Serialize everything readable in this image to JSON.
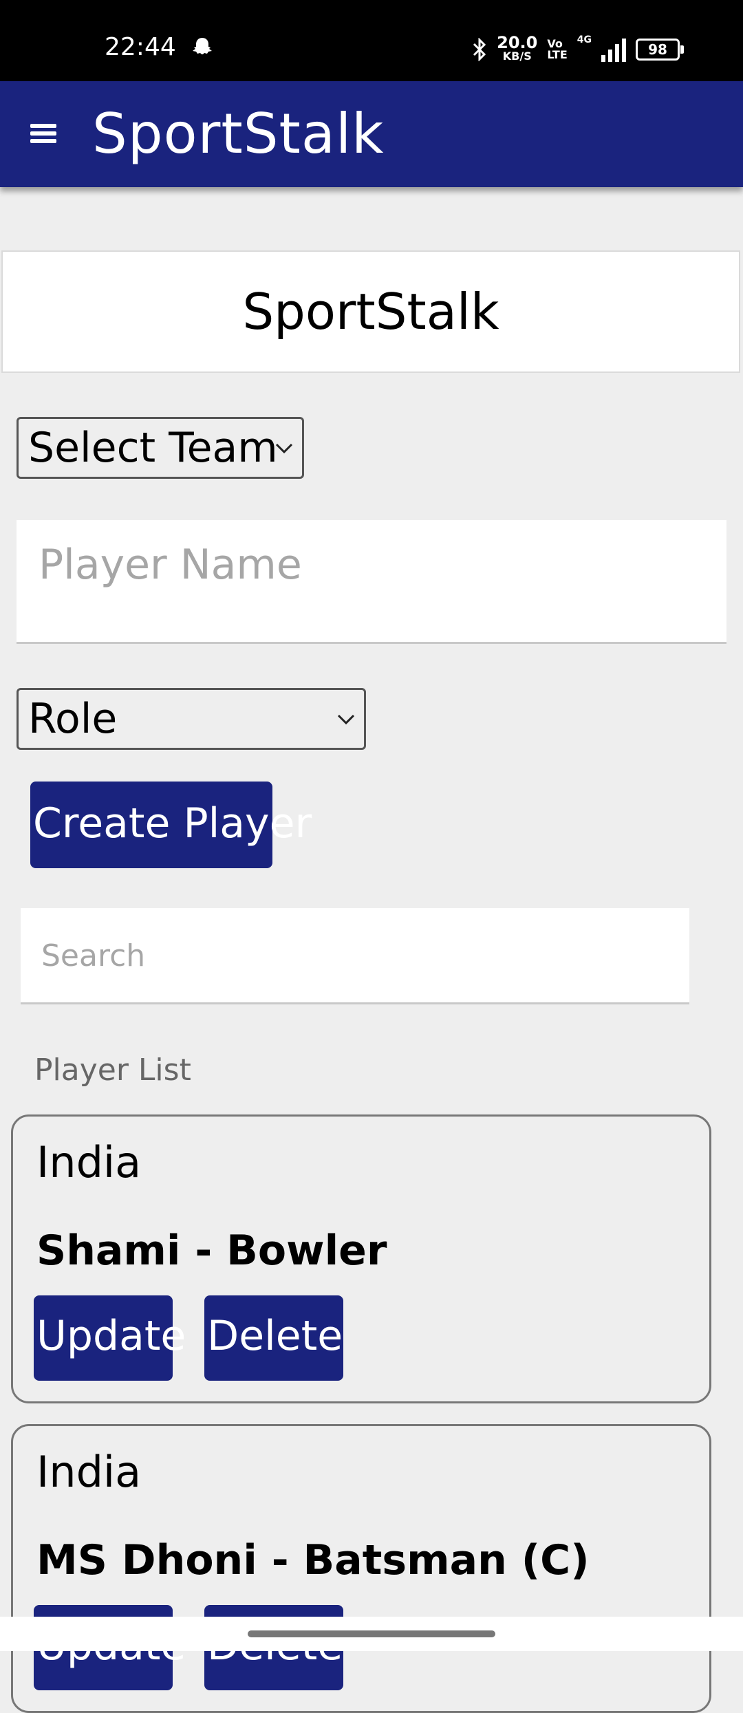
{
  "status_bar": {
    "time": "22:44",
    "net_speed_value": "20.0",
    "net_speed_unit": "KB/S",
    "volte_top": "Vo",
    "volte_bottom": "LTE",
    "network": "4G",
    "battery": "98",
    "icons": [
      "snapchat-icon",
      "bluetooth-icon",
      "signal-icon",
      "battery-icon"
    ]
  },
  "app_bar": {
    "title": "SportStalk",
    "menu_icon": "hamburger-menu-icon",
    "background": "#1a237e"
  },
  "header_card": {
    "title": "SportStalk"
  },
  "form": {
    "team_select": {
      "selected": "Select Team"
    },
    "player_name": {
      "placeholder": "Player Name",
      "value": ""
    },
    "role_select": {
      "selected": "Role"
    },
    "create_button": "Create Player"
  },
  "search": {
    "placeholder": "Search",
    "value": ""
  },
  "player_list": {
    "label": "Player List",
    "players": [
      {
        "team": "India",
        "name": "Shami - Bowler",
        "update_label": "Update",
        "delete_label": "Delete"
      },
      {
        "team": "India",
        "name": "MS Dhoni - Batsman (C)",
        "update_label": "Update",
        "delete_label": "Delete"
      }
    ]
  },
  "colors": {
    "accent": "#1a237e",
    "background": "#eeeeee",
    "status_bar": "#000000"
  }
}
